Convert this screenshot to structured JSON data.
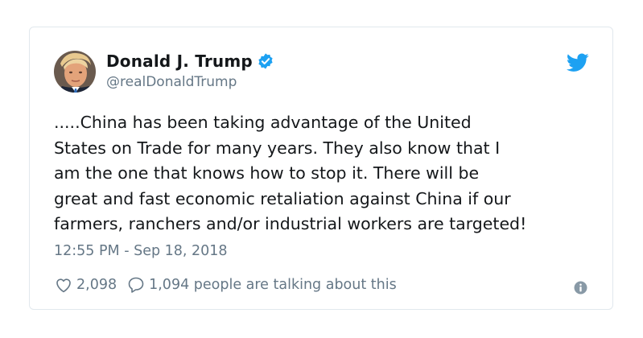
{
  "author": {
    "name": "Donald J. Trump",
    "handle": "@realDonaldTrump",
    "verified": true
  },
  "tweet": {
    "lines": [
      ".....China has been taking advantage of the United",
      "States on Trade for many years. They also know that I",
      "am the one that knows how to stop it. There will be",
      "great and fast economic retaliation against China if our",
      "farmers, ranchers and/or industrial workers are targeted!"
    ],
    "timestamp": "12:55 PM - Sep 18, 2018"
  },
  "actions": {
    "likes": "2,098",
    "conversation": "1,094 people are talking about this"
  },
  "icons": {
    "twitter_bird": "twitter-bird-icon",
    "verified": "verified-badge-icon",
    "like": "heart-icon",
    "reply": "speech-bubble-icon",
    "info": "info-icon"
  },
  "colors": {
    "brand": "#1da1f2",
    "text": "#14171a",
    "muted": "#657786",
    "border": "#e1e8ed"
  }
}
